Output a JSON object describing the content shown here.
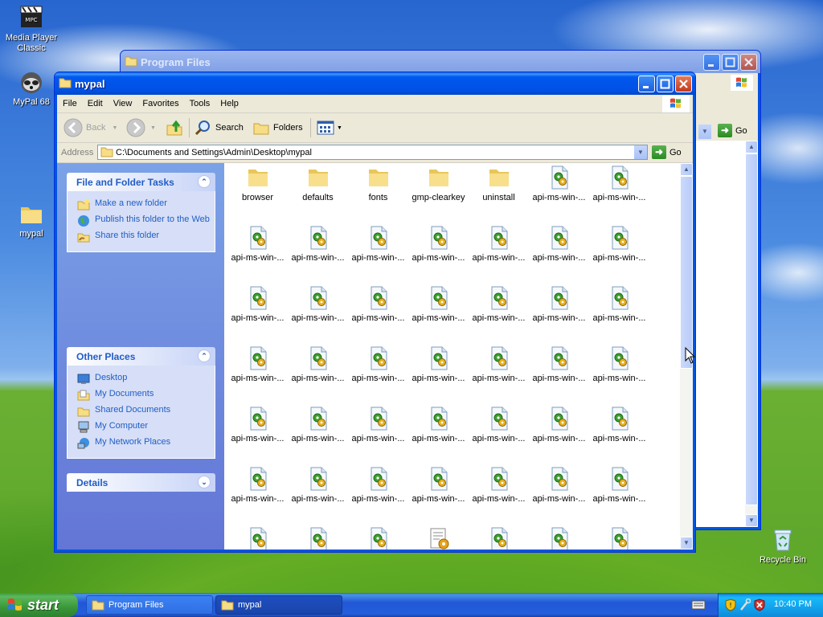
{
  "desktop": {
    "icons": [
      {
        "label": "Media Player Classic",
        "icon": "media-player-classic-icon"
      },
      {
        "label": "MyPal 68",
        "icon": "mypal-icon"
      },
      {
        "label": "mypal",
        "icon": "folder-icon"
      },
      {
        "label": "Recycle Bin",
        "icon": "recycle-bin-icon"
      }
    ]
  },
  "back_window": {
    "title": "Program Files",
    "go_label": "Go"
  },
  "window": {
    "title": "mypal",
    "menu": [
      "File",
      "Edit",
      "View",
      "Favorites",
      "Tools",
      "Help"
    ],
    "toolbar": {
      "back": "Back",
      "search": "Search",
      "folders": "Folders"
    },
    "address": {
      "label": "Address",
      "value": "C:\\Documents and Settings\\Admin\\Desktop\\mypal",
      "go": "Go"
    },
    "tasks": {
      "file_folder": {
        "title": "File and Folder Tasks",
        "items": [
          "Make a new folder",
          "Publish this folder to the Web",
          "Share this folder"
        ]
      },
      "other_places": {
        "title": "Other Places",
        "items": [
          "Desktop",
          "My Documents",
          "Shared Documents",
          "My Computer",
          "My Network Places"
        ]
      },
      "details": {
        "title": "Details"
      }
    },
    "files": [
      [
        "browser",
        "defaults",
        "fonts",
        "gmp-clearkey",
        "uninstall",
        "api-ms-win-...",
        "api-ms-win-..."
      ],
      [
        "api-ms-win-...",
        "api-ms-win-...",
        "api-ms-win-...",
        "api-ms-win-...",
        "api-ms-win-...",
        "api-ms-win-...",
        "api-ms-win-..."
      ],
      [
        "api-ms-win-...",
        "api-ms-win-...",
        "api-ms-win-...",
        "api-ms-win-...",
        "api-ms-win-...",
        "api-ms-win-...",
        "api-ms-win-..."
      ],
      [
        "api-ms-win-...",
        "api-ms-win-...",
        "api-ms-win-...",
        "api-ms-win-...",
        "api-ms-win-...",
        "api-ms-win-...",
        "api-ms-win-..."
      ],
      [
        "api-ms-win-...",
        "api-ms-win-...",
        "api-ms-win-...",
        "api-ms-win-...",
        "api-ms-win-...",
        "api-ms-win-...",
        "api-ms-win-..."
      ],
      [
        "api-ms-win-...",
        "api-ms-win-...",
        "api-ms-win-...",
        "api-ms-win-...",
        "api-ms-win-...",
        "api-ms-win-...",
        "api-ms-win-..."
      ],
      [
        "",
        "",
        "",
        "",
        "",
        "",
        ""
      ]
    ],
    "file_types": [
      [
        "folder",
        "folder",
        "folder",
        "folder",
        "folder",
        "dll",
        "dll"
      ],
      [
        "dll",
        "dll",
        "dll",
        "dll",
        "dll",
        "dll",
        "dll"
      ],
      [
        "dll",
        "dll",
        "dll",
        "dll",
        "dll",
        "dll",
        "dll"
      ],
      [
        "dll",
        "dll",
        "dll",
        "dll",
        "dll",
        "dll",
        "dll"
      ],
      [
        "dll",
        "dll",
        "dll",
        "dll",
        "dll",
        "dll",
        "dll"
      ],
      [
        "dll",
        "dll",
        "dll",
        "dll",
        "dll",
        "dll",
        "dll"
      ],
      [
        "dll",
        "dll",
        "dll",
        "ini",
        "dll",
        "dll",
        "dll"
      ]
    ]
  },
  "taskbar": {
    "start": "start",
    "tasks": [
      "Program Files",
      "mypal"
    ],
    "clock": "10:40 PM"
  },
  "colors": {
    "titlebar": "#0058ee",
    "taskpane": "#6d8ee0",
    "link": "#215dc6"
  }
}
